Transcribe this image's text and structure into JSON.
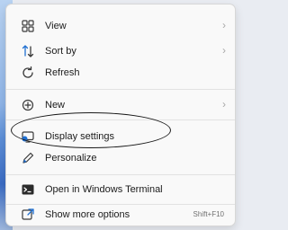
{
  "context_menu": {
    "items": [
      {
        "label": "View",
        "icon": "grid-icon",
        "submenu": true
      },
      {
        "label": "Sort by",
        "icon": "sort-icon",
        "submenu": true
      },
      {
        "label": "Refresh",
        "icon": "refresh-icon",
        "submenu": false
      },
      {
        "label": "New",
        "icon": "new-plus-icon",
        "submenu": true
      },
      {
        "label": "Display settings",
        "icon": "display-icon",
        "submenu": false
      },
      {
        "label": "Personalize",
        "icon": "pen-icon",
        "submenu": false
      },
      {
        "label": "Open in Windows Terminal",
        "icon": "terminal-icon",
        "submenu": false
      },
      {
        "label": "Show more options",
        "icon": "share-icon",
        "submenu": false,
        "shortcut": "Shift+F10"
      }
    ],
    "chevron": "›"
  },
  "colors": {
    "menu_bg": "#f9f9f9",
    "icon_blue": "#1f6fd1",
    "annotation": "#1a1a1a"
  }
}
